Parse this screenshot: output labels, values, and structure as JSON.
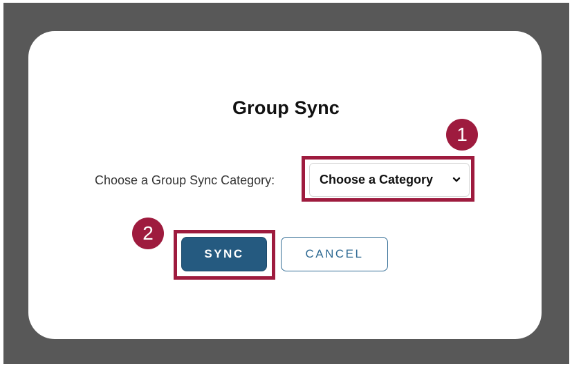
{
  "dialog": {
    "title": "Group Sync",
    "category_label": "Choose a Group Sync Category:",
    "category_select": {
      "selected": "Choose a Category",
      "icon": "chevron-down-icon"
    },
    "buttons": {
      "sync": "SYNC",
      "cancel": "CANCEL"
    }
  },
  "annotations": {
    "step_1": "1",
    "step_2": "2"
  },
  "colors": {
    "backdrop": "#585858",
    "highlight": "#9e1b3e",
    "primary_button": "#255a80",
    "secondary_button_text": "#2f6a93"
  }
}
